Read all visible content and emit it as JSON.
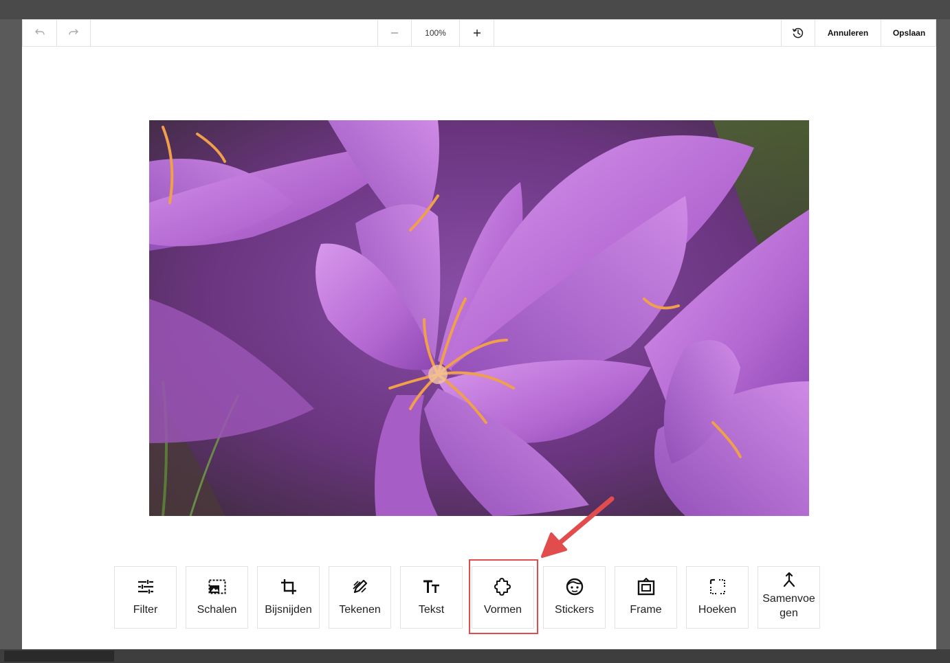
{
  "toolbar": {
    "undo_icon": "undo-icon",
    "redo_icon": "redo-icon",
    "zoom_out_icon": "minus-icon",
    "zoom_value": "100%",
    "zoom_in_icon": "plus-icon",
    "history_icon": "history-icon",
    "cancel_label": "Annuleren",
    "save_label": "Opslaan"
  },
  "tools": [
    {
      "label": "Filter",
      "icon": "sliders-icon"
    },
    {
      "label": "Schalen",
      "icon": "resize-icon"
    },
    {
      "label": "Bijsnijden",
      "icon": "crop-icon"
    },
    {
      "label": "Tekenen",
      "icon": "draw-icon"
    },
    {
      "label": "Tekst",
      "icon": "text-icon"
    },
    {
      "label": "Vormen",
      "icon": "puzzle-shape-icon"
    },
    {
      "label": "Stickers",
      "icon": "smiley-sticker-icon"
    },
    {
      "label": "Frame",
      "icon": "frame-icon"
    },
    {
      "label": "Hoeken",
      "icon": "corners-icon"
    },
    {
      "label": "Samenvoegen",
      "icon": "merge-icon"
    }
  ],
  "tool_labels_display": {
    "samenvoegen_line1": "Samenvoe",
    "samenvoegen_line2": "gen"
  },
  "colors": {
    "highlight": "#e14d4d",
    "arrow": "#e14d4d",
    "flower_purple": "#b36fd0"
  },
  "annotation": {
    "highlighted_tool": "Vormen"
  }
}
